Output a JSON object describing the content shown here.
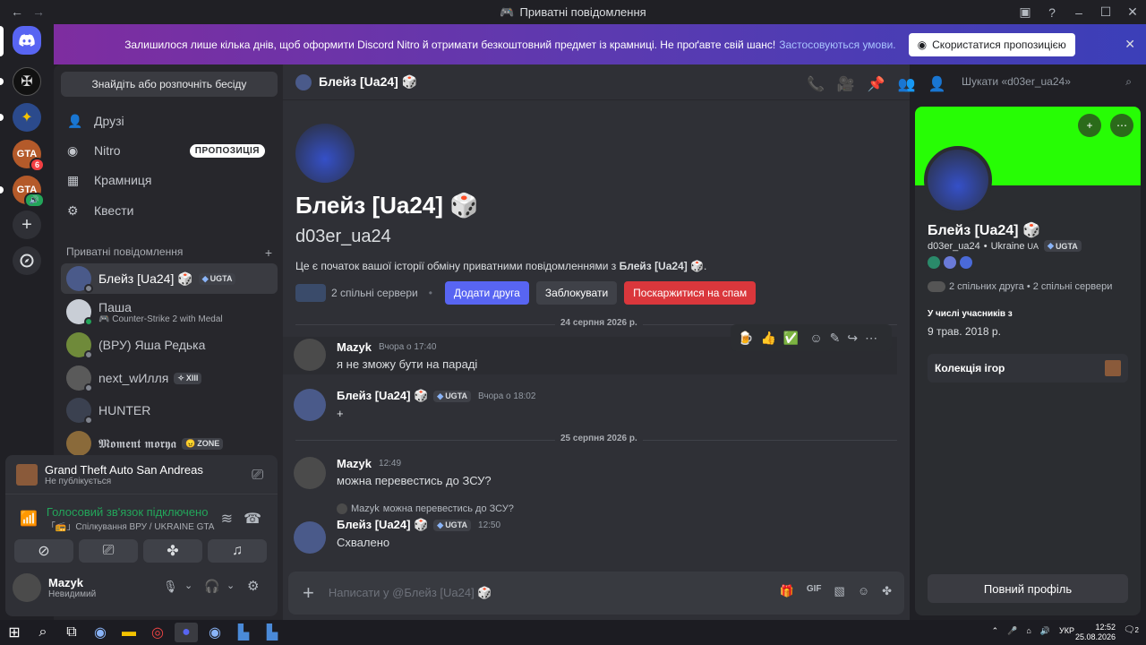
{
  "titlebar": {
    "title": "Приватні повідомлення"
  },
  "banner": {
    "text": "Залишилося лише кілька днів, щоб оформити Discord Nitro й отримати безкоштовний предмет із крамниці. Не проґавте свій шанс!",
    "link": "Застосовуються умови.",
    "button": "Скористатися пропозицією"
  },
  "servers": {
    "badge_count": "6"
  },
  "sidebar": {
    "find_label": "Знайдіть або розпочніть бесіду",
    "menu": [
      {
        "label": "Друзі"
      },
      {
        "label": "Nitro",
        "badge": "ПРОПОЗИЦІЯ"
      },
      {
        "label": "Крамниця"
      },
      {
        "label": "Квести"
      }
    ],
    "dm_header": "Приватні повідомлення",
    "dms": [
      {
        "name": "Блейз [Ua24] 🎲",
        "tag": "UGTA"
      },
      {
        "name": "Паша",
        "sub": "Counter-Strike 2 with Medal"
      },
      {
        "name": "(ВРУ) Яша Редька"
      },
      {
        "name": "next_wИлля",
        "tag": "XIII"
      },
      {
        "name": "HUNTER"
      },
      {
        "name": "𝕸𝖔𝖒𝖊𝖓𝖙 𝖒𝖔𝖗𝖞𝖆",
        "tag": "ZONE"
      }
    ],
    "game": {
      "title": "Grand Theft Auto San Andreas",
      "status": "Не публікується"
    },
    "voice": {
      "status": "Голосовий зв'язок підключено",
      "channel": "Спілкування ВРУ / UKRAINE GTA"
    },
    "user": {
      "name": "Mazyk",
      "status": "Невидимий"
    }
  },
  "chat": {
    "header_name": "Блейз [Ua24] 🎲",
    "search_placeholder": "Шукати «d03er_ua24»",
    "intro": {
      "name": "Блейз [Ua24] 🎲",
      "username": "d03er_ua24",
      "desc_prefix": "Це є початок вашої історії обміну приватними повідомленнями з ",
      "desc_name": "Блейз [Ua24] 🎲",
      "mutual": "2 спільні сервери",
      "add_friend": "Додати друга",
      "block": "Заблокувати",
      "report": "Поскаржитися на спам"
    },
    "dates": [
      "24 серпня 2026 р.",
      "25 серпня 2026 р."
    ],
    "messages": [
      {
        "author": "Mazyk",
        "time": "Вчора о 17:40",
        "text": "я не зможу бути на параді"
      },
      {
        "author": "Блейз [Ua24] 🎲",
        "tag": "UGTA",
        "time": "Вчора о 18:02",
        "text": "+"
      },
      {
        "author": "Mazyk",
        "time": "12:49",
        "text": "можна перевестись до ЗСУ?"
      },
      {
        "author": "Блейз [Ua24] 🎲",
        "tag": "UGTA",
        "time": "12:50",
        "text": "Схвалено",
        "reply_author": "Mazyk",
        "reply_text": "можна перевестись до ЗСУ?"
      }
    ],
    "hover_emojis": [
      "🍺",
      "👍",
      "✅"
    ],
    "composer_placeholder": "Написати у @Блейз [Ua24] 🎲"
  },
  "profile": {
    "name": "Блейз [Ua24] 🎲",
    "username": "d03er_ua24",
    "country": "Ukraine",
    "country_code": "UA",
    "tag": "UGTA",
    "mutual": "2 спільних друга • 2 спільні сервери",
    "member_label": "У числі учасників з",
    "member_date": "9 трав. 2018 р.",
    "collection": "Колекція ігор",
    "full_profile": "Повний профіль",
    "banner_color": "#27fd05"
  },
  "taskbar": {
    "lang": "УКР",
    "time": "12:52",
    "date": "25.08.2026",
    "notif": "2"
  }
}
